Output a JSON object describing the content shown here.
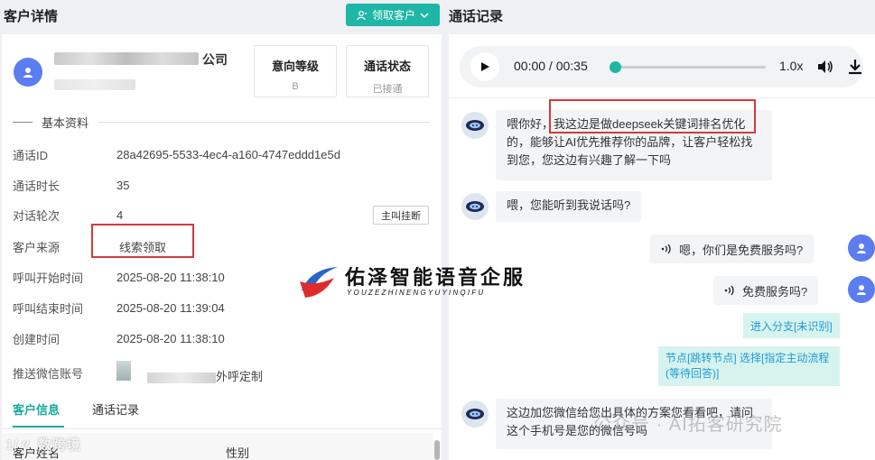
{
  "left": {
    "title": "客户详情",
    "claim_button": "领取客户",
    "company_suffix": "公司",
    "stats": [
      {
        "label": "意向等级",
        "value": "B"
      },
      {
        "label": "通话状态",
        "value": "已接通"
      }
    ],
    "section_title": "基本资料",
    "fields": [
      {
        "key": "通话ID",
        "value": "28a42695-5533-4ec4-a160-4747eddd1e5d"
      },
      {
        "key": "通话时长",
        "value": "35"
      },
      {
        "key": "对话轮次",
        "value": "4"
      },
      {
        "key": "客户来源",
        "value": "线索领取"
      },
      {
        "key": "呼叫开始时间",
        "value": "2025-08-20 11:38:10"
      },
      {
        "key": "呼叫结束时间",
        "value": "2025-08-20 11:39:04"
      },
      {
        "key": "创建时间",
        "value": "2025-08-20 11:38:10"
      },
      {
        "key": "推送微信账号",
        "value": "外呼定制"
      }
    ],
    "hangup_button": "主叫挂断",
    "tabs": [
      "客户信息",
      "通话记录"
    ],
    "sub_row": {
      "name_label": "客户姓名",
      "gender_label": "性别"
    },
    "watermark": "数跨境"
  },
  "right": {
    "title": "通话记录",
    "player": {
      "time": "00:00 / 00:35",
      "progress": 0,
      "speed": "1.0x"
    },
    "messages": [
      {
        "role": "bot",
        "text": "喂你好，我这边是做deepseek关键词排名优化的，能够让AI优先推荐你的品牌，让客户轻松找到您，您这边有兴趣了解一下吗"
      },
      {
        "role": "bot",
        "text": "喂，您能听到我说话吗?"
      },
      {
        "role": "user",
        "text": "嗯，你们是免费服务吗?"
      },
      {
        "role": "user",
        "text": "免费服务吗?"
      },
      {
        "role": "tag",
        "text": "进入分支[未识别]"
      },
      {
        "role": "tag",
        "text": "节点[跳转节点] 选择[指定主动流程(等待回答)]"
      },
      {
        "role": "bot",
        "text": "这边加您微信给您出具体的方案您看看吧，请问这个手机号是您的微信号吗"
      }
    ],
    "watermark": "公众号 · AI拓客研究院"
  },
  "logo": {
    "cn": "佑泽智能语音企服",
    "en": "YOUZEZHINENGYUYINQIFU"
  },
  "colors": {
    "accent": "#1fb6a7",
    "user_avatar": "#5b7df0",
    "highlight": "#d43a3a"
  }
}
